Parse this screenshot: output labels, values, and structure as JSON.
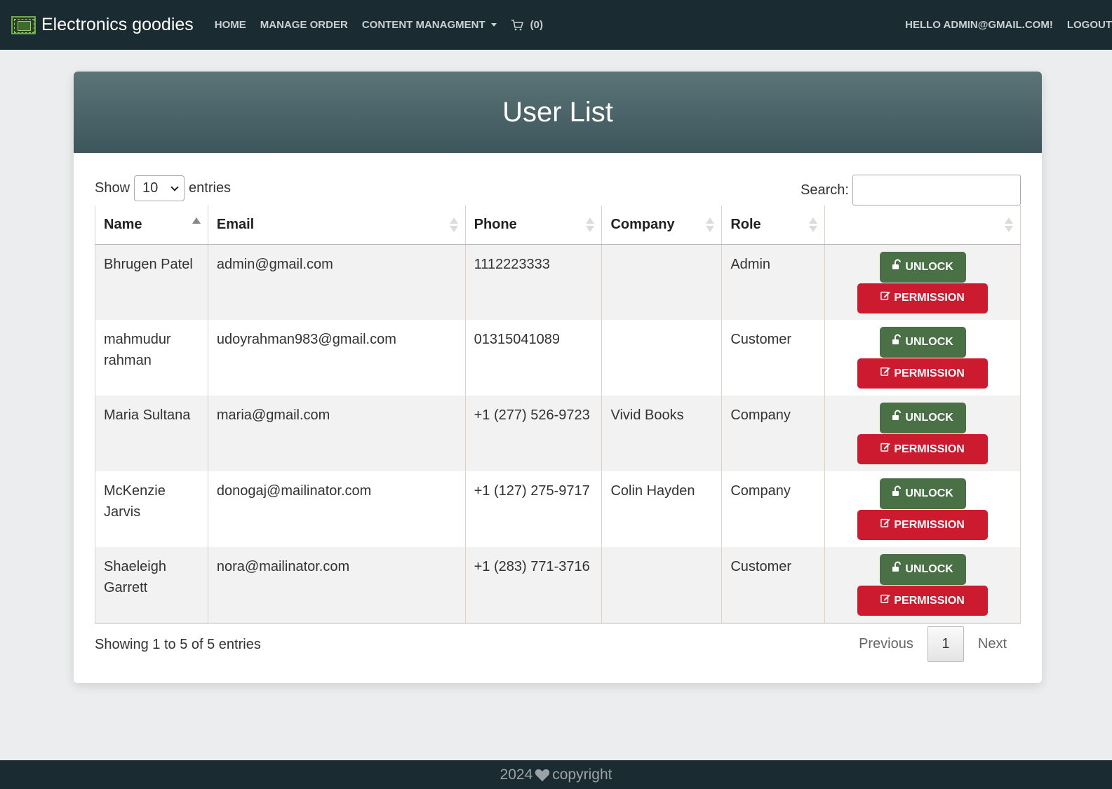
{
  "navbar": {
    "brand": "Electronics goodies",
    "links": [
      "HOME",
      "MANAGE ORDER",
      "CONTENT MANAGMENT"
    ],
    "cart_count": "(0)",
    "greeting": "HELLO ADMIN@GMAIL.COM!",
    "logout": "LOGOUT"
  },
  "card": {
    "title": "User List",
    "show_label": "Show",
    "entries_value": "10",
    "entries_label": "entries",
    "search_label": "Search:",
    "search_value": ""
  },
  "table": {
    "columns": [
      "Name",
      "Email",
      "Phone",
      "Company",
      "Role",
      ""
    ],
    "sorted_column": "Name",
    "rows": [
      {
        "name": "Bhrugen Patel",
        "email": "admin@gmail.com",
        "phone": "1112223333",
        "company": "",
        "role": "Admin"
      },
      {
        "name": "mahmudur rahman",
        "email": "udoyrahman983@gmail.com",
        "phone": "01315041089",
        "company": "",
        "role": "Customer"
      },
      {
        "name": "Maria Sultana",
        "email": "maria@gmail.com",
        "phone": "+1 (277) 526-9723",
        "company": "Vivid Books",
        "role": "Company"
      },
      {
        "name": "McKenzie Jarvis",
        "email": "donogaj@mailinator.com",
        "phone": "+1 (127) 275-9717",
        "company": "Colin Hayden",
        "role": "Company"
      },
      {
        "name": "Shaeleigh Garrett",
        "email": "nora@mailinator.com",
        "phone": "+1 (283) 771-3716",
        "company": "",
        "role": "Customer"
      }
    ],
    "unlock_label": "UNLOCK",
    "permission_label": "PERMISSION"
  },
  "footer_table": {
    "info": "Showing 1 to 5 of 5 entries",
    "previous": "Previous",
    "page": "1",
    "next": "Next"
  },
  "footer": {
    "year": "2024",
    "text": "copyright"
  },
  "colors": {
    "navbar": "#1a2b31",
    "unlock": "#4a7046",
    "permission": "#cc1a2e",
    "header_gradient_top": "#5b7478"
  }
}
